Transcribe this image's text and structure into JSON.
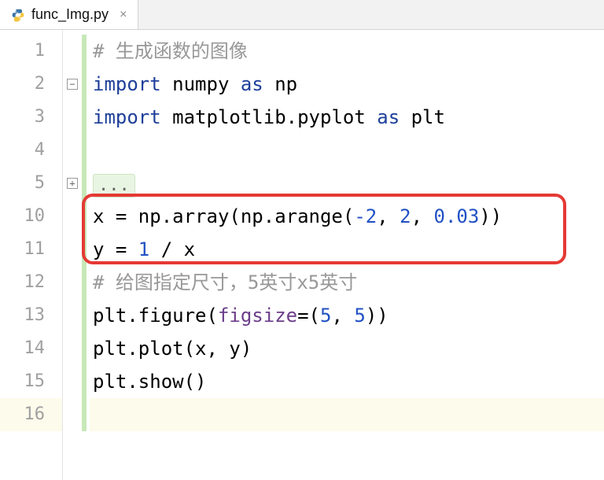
{
  "tab": {
    "filename": "func_Img.py",
    "close_glyph": "×"
  },
  "gutter": {
    "lines": [
      "1",
      "2",
      "3",
      "4",
      "5",
      "10",
      "11",
      "12",
      "13",
      "14",
      "15",
      "16"
    ]
  },
  "fold": {
    "collapsed_placeholder": "..."
  },
  "code": {
    "l1_comment": "# 生成函数的图像",
    "l2_import": "import",
    "l2_mod": " numpy ",
    "l2_as": "as",
    "l2_alias": " np",
    "l3_import": "import",
    "l3_mod": " matplotlib.pyplot ",
    "l3_as": "as",
    "l3_alias": " plt",
    "l10_a": "x = np.array(np.arange(",
    "l10_n1": "-2",
    "l10_c1": ", ",
    "l10_n2": "2",
    "l10_c2": ", ",
    "l10_n3": "0.03",
    "l10_b": "))",
    "l11_a": "y = ",
    "l11_n1": "1",
    "l11_b": " / x",
    "l12_comment": "# 给图指定尺寸，5英寸x5英寸",
    "l13_a": "plt.figure(",
    "l13_kw": "figsize",
    "l13_b": "=(",
    "l13_n1": "5",
    "l13_c": ", ",
    "l13_n2": "5",
    "l13_d": "))",
    "l14": "plt.plot(x, y)",
    "l15": "plt.show()"
  }
}
